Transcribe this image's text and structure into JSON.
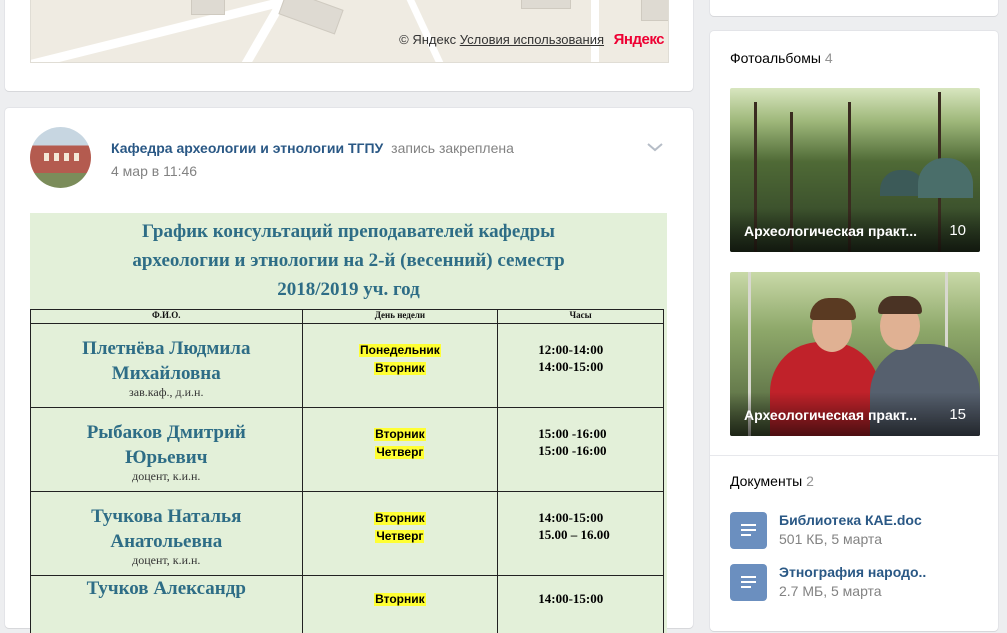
{
  "map": {
    "attribution_prefix": "© Яндекс",
    "terms_link": "Условия использования",
    "logo": "Яндекс"
  },
  "post": {
    "author": "Кафедра археологии и этнологии ТГПУ",
    "pinned": "запись закреплена",
    "date": "4 мар в 11:46",
    "menu_icon": "chevron-down-icon",
    "image": {
      "title_lines": [
        "График консультаций преподавателей кафедры",
        "археологии и этнологии на 2-й (весенний) семестр",
        "2018/2019 уч. год"
      ],
      "columns": [
        "Ф.И.О.",
        "День недели",
        "Часы"
      ],
      "rows": [
        {
          "name1": "Плетнёва Людмила",
          "name2": "Михайловна",
          "rank": "зав.каф., д.и.н.",
          "day1": "Понедельник",
          "day2": "Вторник",
          "hours1": "12:00-14:00",
          "hours2": "14:00-15:00"
        },
        {
          "name1": "Рыбаков  Дмитрий",
          "name2": "Юрьевич",
          "rank": "доцент, к.и.н.",
          "day1": "Вторник",
          "day2": "Четверг",
          "hours1": "15:00 -16:00",
          "hours2": "15:00 -16:00"
        },
        {
          "name1": "Тучкова Наталья",
          "name2": "Анатольевна",
          "rank": "доцент, к.и.н.",
          "day1": "Вторник",
          "day2": "Четверг",
          "hours1": "14:00-15:00",
          "hours2": "15.00 – 16.00"
        },
        {
          "name1": "Тучков Александр",
          "name2": "",
          "rank": "",
          "day1": "Вторник",
          "day2": "",
          "hours1": "14:00-15:00",
          "hours2": ""
        }
      ]
    }
  },
  "albums": {
    "title": "Фотоальбомы",
    "count": "4",
    "items": [
      {
        "name": "Археологическая практ...",
        "count": "10"
      },
      {
        "name": "Археологическая практ...",
        "count": "15"
      }
    ]
  },
  "documents": {
    "title": "Документы",
    "count": "2",
    "items": [
      {
        "name": "Библиотека КАЕ.doc",
        "meta": "501 КБ, 5 марта"
      },
      {
        "name": "Этнография народо..",
        "meta": "2.7 МБ, 5 марта"
      }
    ]
  }
}
